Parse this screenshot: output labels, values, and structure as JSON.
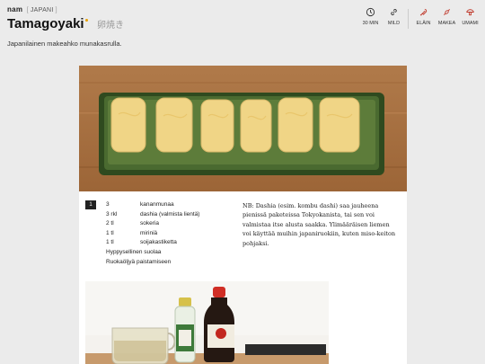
{
  "header": {
    "logo": "nam",
    "category": "JAPANI",
    "title": "Tamagoyaki",
    "title_jp": "卵焼き",
    "subtitle": "Japanilainen makeahko munakasrulla."
  },
  "tags": [
    {
      "label": "30 MIN",
      "icon": "clock-icon"
    },
    {
      "label": "MILD",
      "icon": "link-icon"
    },
    {
      "label": "ELÄIN",
      "icon": "meat-icon"
    },
    {
      "label": "MAKEA",
      "icon": "candy-icon"
    },
    {
      "label": "UMAMI",
      "icon": "mushroom-icon"
    }
  ],
  "recipe": {
    "step_number": "1",
    "ingredients": [
      {
        "amount": "3",
        "name": "kananmunaa"
      },
      {
        "amount": "3 rkl",
        "name": "dashia (valmista lientä)"
      },
      {
        "amount": "2 tl",
        "name": "sokeria"
      },
      {
        "amount": "1 tl",
        "name": "miriniä"
      },
      {
        "amount": "1 tl",
        "name": "soijakastiketta"
      },
      {
        "amount": "Hyppysellinen suolaa",
        "name": ""
      },
      {
        "amount": "Ruokaöljyä paistamiseen",
        "name": ""
      }
    ],
    "note": "NB: Dashia (esim. kombu dashi) saa jauheena pienissä paketeissa Tokyokanista, tai sen voi valmistaa itse alusta saakka. Ylimääräisen liemen voi käyttää muihin japaniruokiin, kuten miso-keiton pohjaksi."
  },
  "colors": {
    "page_bg": "#ebebeb",
    "accent_dot": "#e8a000"
  }
}
